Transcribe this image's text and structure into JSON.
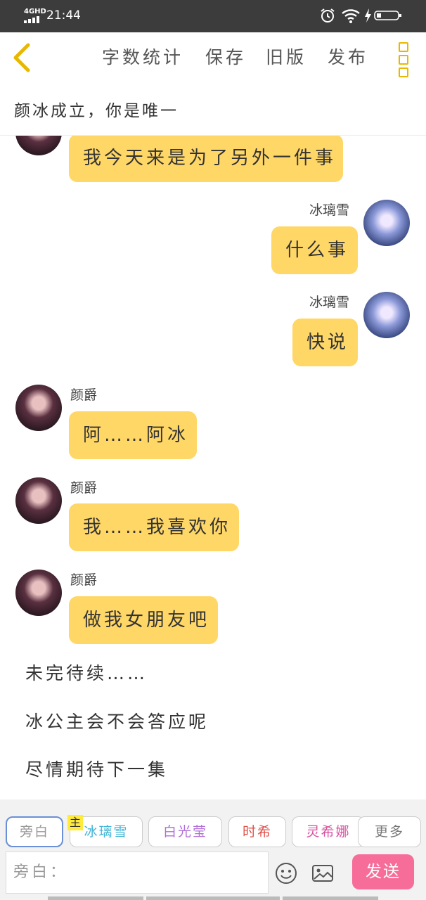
{
  "status_bar": {
    "network": "4GHD",
    "time": "21:44"
  },
  "toolbar": {
    "back_icon": "chevron-left-icon",
    "word_count": "字数统计",
    "save": "保存",
    "old_version": "旧版",
    "publish": "发布",
    "more_icon": "more-vertical-icon",
    "accent": "#e8b800"
  },
  "story_title": "颜冰成立，你是唯一",
  "messages": [
    {
      "speaker": "",
      "text": "我今天来是为了另外一件事",
      "side": "left"
    },
    {
      "speaker": "冰璃雪",
      "text": "什么事",
      "side": "right"
    },
    {
      "speaker": "冰璃雪",
      "text": "快说",
      "side": "right"
    },
    {
      "speaker": "颜爵",
      "text": "阿……阿冰",
      "side": "left"
    },
    {
      "speaker": "颜爵",
      "text": "我……我喜欢你",
      "side": "left"
    },
    {
      "speaker": "颜爵",
      "text": "做我女朋友吧",
      "side": "left"
    }
  ],
  "narration": [
    "未完待续……",
    "冰公主会不会答应呢",
    "尽情期待下一集"
  ],
  "characters": [
    {
      "label": "旁白",
      "color": "#999999",
      "selected": true
    },
    {
      "label": "冰璃雪",
      "color": "#3fb3d6",
      "badge": "主"
    },
    {
      "label": "白光莹",
      "color": "#b06fd8"
    },
    {
      "label": "时希",
      "color": "#e0504a"
    },
    {
      "label": "灵希娜",
      "color": "#d84fa0"
    },
    {
      "label": "更多",
      "color": "#777777"
    }
  ],
  "input": {
    "placeholder": "旁白："
  },
  "send_label": "发送",
  "colors": {
    "bubble": "#ffd766",
    "send": "#f76d9a"
  }
}
